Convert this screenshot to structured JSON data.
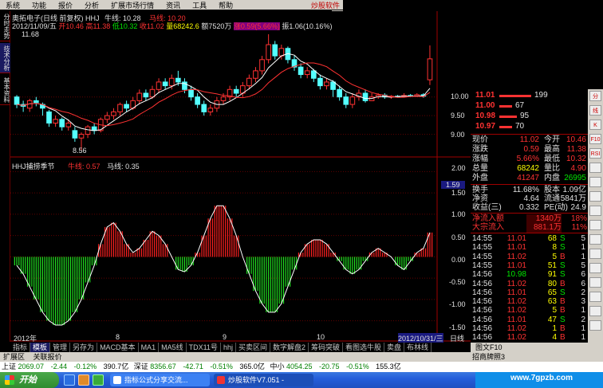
{
  "menu": {
    "items": [
      "系统",
      "功能",
      "报价",
      "分析",
      "扩展市场行情",
      "资讯",
      "工具",
      "帮助"
    ],
    "brand": "炒股软件"
  },
  "left_tabs": [
    "分时走势",
    "技术分析",
    "基本资料"
  ],
  "header": {
    "stock_line": "奥拓电子(日线 前复权) HHJ",
    "niu_label": "牛线: 10.28",
    "ma_label": "马线: 10.20",
    "info_date": "2012/11/09/五",
    "info_open": "开10.46",
    "info_high": "高11.38",
    "info_low": "低10.32",
    "info_close": "收11.02",
    "info_volume": "量68242.6",
    "info_amount": "额7520万",
    "info_change": "涨0.59(5.66%)",
    "info_amplitude": "振1.06(10.16%)",
    "price_max_label": "11.68",
    "price_min_label": "8.56"
  },
  "indicator": {
    "name": "HHJ捕捞季节",
    "niu": "牛线: 0.57",
    "ma": "马线: 0.35"
  },
  "price_axis": [
    "10.00",
    "9.50",
    "9.00"
  ],
  "ind_axis": [
    "2.00",
    "1.50",
    "1.00",
    "0.50",
    "0.00",
    "-0.50",
    "-1.00",
    "-1.50"
  ],
  "ind_highlight": "1.59",
  "date_axis": {
    "start": "2012年",
    "m8": "8",
    "m9": "9",
    "m10": "10",
    "cursor": "2012/10/31/三",
    "end": "日线"
  },
  "order_book": [
    {
      "price": "11.01",
      "vol": "199"
    },
    {
      "price": "11.00",
      "vol": "67"
    },
    {
      "price": "10.98",
      "vol": "95"
    },
    {
      "price": "10.97",
      "vol": "70"
    }
  ],
  "quote": [
    [
      "现价",
      "11.02",
      "今开",
      "10.46"
    ],
    [
      "涨跌",
      "0.59",
      "最高",
      "11.38"
    ],
    [
      "涨幅",
      "5.66%",
      "最低",
      "10.32"
    ],
    [
      "总量",
      "68242",
      "量比",
      "4.90"
    ],
    [
      "外盘",
      "41247",
      "内盘",
      "26995"
    ]
  ],
  "stats": [
    [
      "换手",
      "11.68%",
      "股本",
      "1.09亿"
    ],
    [
      "净资",
      "4.64",
      "流通",
      "5841万"
    ],
    [
      "收益(三)",
      "0.332",
      "PE(动)",
      "24.9"
    ]
  ],
  "flows": [
    [
      "净流入额",
      "1340万",
      "18%"
    ],
    [
      "大宗流入",
      "881.1万",
      "11%"
    ]
  ],
  "ticks": [
    [
      "14:55",
      "11.01",
      "68",
      "S",
      "5"
    ],
    [
      "14:55",
      "11.01",
      "8",
      "S",
      "1"
    ],
    [
      "14:55",
      "11.02",
      "5",
      "B",
      "1"
    ],
    [
      "14:55",
      "11.01",
      "51",
      "S",
      "5"
    ],
    [
      "14:56",
      "10.98",
      "91",
      "S",
      "6"
    ],
    [
      "14:56",
      "11.02",
      "80",
      "B",
      "6"
    ],
    [
      "14:56",
      "11.01",
      "65",
      "S",
      "2"
    ],
    [
      "14:56",
      "11.02",
      "63",
      "B",
      "3"
    ],
    [
      "14:56",
      "11.02",
      "5",
      "B",
      "1"
    ],
    [
      "14:56",
      "11.01",
      "47",
      "S",
      "2"
    ],
    [
      "14:56",
      "11.02",
      "1",
      "B",
      "1"
    ],
    [
      "14:56",
      "11.02",
      "4",
      "B",
      "1"
    ],
    [
      "15:00",
      "11.02",
      "738",
      "",
      "49"
    ]
  ],
  "right_tools": [
    "分",
    "线",
    "K",
    "F10",
    "RSI",
    "",
    "",
    "",
    "",
    "",
    "",
    "",
    "",
    "",
    "",
    "",
    ""
  ],
  "bottom_tabs": [
    "指标",
    "模板",
    "管理",
    "另存为",
    "MACD基本",
    "MA1",
    "MA5线",
    "TDX11号",
    "hhj",
    "买卖区间",
    "数字解盘2",
    "筹码突破",
    "看图选牛股",
    "卖盘",
    "布林线"
  ],
  "right_bottom_tabs": [
    "图文F10"
  ],
  "right_bottom_tabs2": [
    "招商牌照3"
  ],
  "sub_tabs": [
    "扩展区",
    "关联报价"
  ],
  "ticker": [
    {
      "name": "上证",
      "price": "2069.07",
      "chg": "-2.44",
      "pct": "-0.12%",
      "amt": "390.7亿"
    },
    {
      "name": "深证",
      "price": "8356.67",
      "chg": "-42.71",
      "pct": "-0.51%",
      "amt": "365.0亿"
    },
    {
      "name": "中小",
      "price": "4054.25",
      "chg": "-20.75",
      "pct": "-0.51%",
      "amt": "155.3亿"
    }
  ],
  "taskbar": {
    "start": "开始",
    "task1": "指标公式分享交流...",
    "task2": "炒股软件V7.051 -"
  },
  "watermark": "www.7gpzb.com",
  "chart_data": {
    "type": "candlestick+bar",
    "candles": [
      [
        10.0,
        9.8,
        10.05,
        9.7
      ],
      [
        9.8,
        9.75,
        9.9,
        9.6
      ],
      [
        9.7,
        9.9,
        9.95,
        9.6
      ],
      [
        9.9,
        9.85,
        10.0,
        9.75
      ],
      [
        9.8,
        9.7,
        9.85,
        9.5
      ],
      [
        9.6,
        9.3,
        9.65,
        9.2
      ],
      [
        9.3,
        9.4,
        9.5,
        9.2
      ],
      [
        9.4,
        9.2,
        9.45,
        9.1
      ],
      [
        9.2,
        9.3,
        9.4,
        9.1
      ],
      [
        9.1,
        8.9,
        9.2,
        8.8
      ],
      [
        8.9,
        9.0,
        9.05,
        8.56
      ],
      [
        9.0,
        9.2,
        9.25,
        8.9
      ],
      [
        9.2,
        9.1,
        9.3,
        9.0
      ],
      [
        9.1,
        9.4,
        9.45,
        9.05
      ],
      [
        9.4,
        9.5,
        9.6,
        9.3
      ],
      [
        9.5,
        9.6,
        9.7,
        9.4
      ],
      [
        9.6,
        9.8,
        9.85,
        9.5
      ],
      [
        9.8,
        9.7,
        9.9,
        9.6
      ],
      [
        9.7,
        9.9,
        10.0,
        9.65
      ],
      [
        9.9,
        10.1,
        10.2,
        9.8
      ],
      [
        10.1,
        10.0,
        10.2,
        9.9
      ],
      [
        10.0,
        10.2,
        10.3,
        9.95
      ],
      [
        10.2,
        10.4,
        10.5,
        10.1
      ],
      [
        10.4,
        10.3,
        10.5,
        10.2
      ],
      [
        10.3,
        10.5,
        10.6,
        10.2
      ],
      [
        10.5,
        10.4,
        10.7,
        10.3
      ],
      [
        10.4,
        10.2,
        10.5,
        10.1
      ],
      [
        10.2,
        10.0,
        10.3,
        9.9
      ],
      [
        10.0,
        9.8,
        10.1,
        9.7
      ],
      [
        9.8,
        9.6,
        9.9,
        9.5
      ],
      [
        9.6,
        9.7,
        9.8,
        9.5
      ],
      [
        9.7,
        9.9,
        10.0,
        9.6
      ],
      [
        9.9,
        10.0,
        10.1,
        9.8
      ],
      [
        10.0,
        10.2,
        10.3,
        9.9
      ],
      [
        10.2,
        10.1,
        10.3,
        10.0
      ],
      [
        10.1,
        10.3,
        10.4,
        10.0
      ],
      [
        10.3,
        10.5,
        10.6,
        10.2
      ],
      [
        10.5,
        10.7,
        10.8,
        10.4
      ],
      [
        10.7,
        11.0,
        11.1,
        10.6
      ],
      [
        11.0,
        11.4,
        11.68,
        10.9
      ],
      [
        11.4,
        11.1,
        11.5,
        11.0
      ],
      [
        11.1,
        11.3,
        11.4,
        11.0
      ],
      [
        11.3,
        11.0,
        11.35,
        10.9
      ],
      [
        11.0,
        10.8,
        11.1,
        10.7
      ],
      [
        10.8,
        10.6,
        10.9,
        10.5
      ],
      [
        10.6,
        10.7,
        10.8,
        10.5
      ],
      [
        10.7,
        10.5,
        10.75,
        10.4
      ],
      [
        10.5,
        10.3,
        10.6,
        10.2
      ],
      [
        10.3,
        10.4,
        10.5,
        10.2
      ],
      [
        10.4,
        10.2,
        10.45,
        10.0
      ],
      [
        10.2,
        10.0,
        10.3,
        9.9
      ],
      [
        10.0,
        9.8,
        10.1,
        9.7
      ],
      [
        9.8,
        10.0,
        10.1,
        9.7
      ],
      [
        10.0,
        10.1,
        10.2,
        9.9
      ],
      [
        10.1,
        9.9,
        10.2,
        9.85
      ],
      [
        9.9,
        10.0,
        10.1,
        9.9
      ],
      [
        10.0,
        10.05,
        10.1,
        9.95
      ],
      [
        10.05,
        10.0,
        10.1,
        9.95
      ],
      [
        10.0,
        10.02,
        10.05,
        9.95
      ],
      [
        10.02,
        10.0,
        10.05,
        9.98
      ],
      [
        10.0,
        10.04,
        10.1,
        9.98
      ],
      [
        10.04,
        10.02,
        10.08,
        10.0
      ],
      [
        10.02,
        10.06,
        10.1,
        10.0
      ],
      [
        10.06,
        10.02,
        10.1,
        9.98
      ],
      [
        10.46,
        11.02,
        11.38,
        10.32
      ]
    ],
    "indicator_values": [
      -0.2,
      -0.4,
      -0.7,
      -1.0,
      -1.3,
      -1.5,
      -1.6,
      -1.6,
      -1.5,
      -1.3,
      -1.0,
      -0.6,
      -0.2,
      0.3,
      0.7,
      0.8,
      0.6,
      0.3,
      0.1,
      0.2,
      0.4,
      0.6,
      0.5,
      0.3,
      0.0,
      -0.3,
      -0.35,
      -0.2,
      0.1,
      0.5,
      0.9,
      1.2,
      1.2,
      0.9,
      0.5,
      0.0,
      -0.4,
      -0.8,
      -1.1,
      -1.3,
      -1.3,
      -1.1,
      -0.7,
      -0.3,
      0.1,
      0.3,
      0.4,
      0.4,
      0.3,
      0.1,
      -0.1,
      -0.3,
      -0.4,
      -0.3,
      -0.1,
      0.1,
      0.2,
      0.1,
      0.0,
      -0.2,
      -0.3,
      -0.1,
      0.1,
      0.2,
      0.57
    ]
  }
}
